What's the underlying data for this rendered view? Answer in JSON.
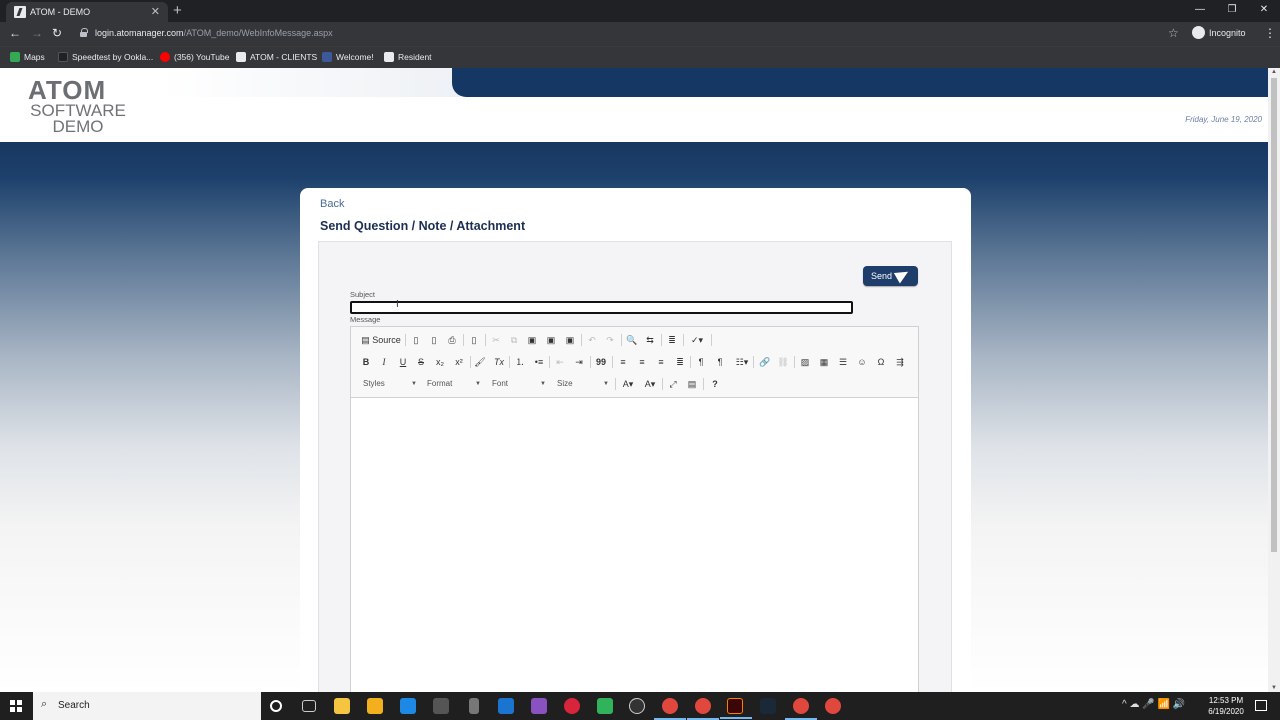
{
  "browser": {
    "tab_title": "ATOM - DEMO",
    "tab_close": "✕",
    "new_tab": "+",
    "url_host": "login.atomanager.com",
    "url_path": "/ATOM_demo/WebInfoMessage.aspx",
    "incognito_label": "Incognito",
    "window_controls": [
      "—",
      "❐",
      "✕"
    ],
    "bookmarks": [
      {
        "label": "Maps",
        "color": "#34a853"
      },
      {
        "label": "Speedtest by Ookla...",
        "color": "#202124"
      },
      {
        "label": "(356) YouTube",
        "color": "#ff0000"
      },
      {
        "label": "ATOM - CLIENTS",
        "color": "#e8eaed"
      },
      {
        "label": "Welcome!",
        "color": "#3c5a99"
      },
      {
        "label": "Resident",
        "color": "#e8eaed"
      }
    ]
  },
  "header": {
    "logo_top": "ATOM",
    "logo_mid": "SOFTWARE",
    "logo_bottom": "DEMO",
    "date": "Friday, June 19, 2020"
  },
  "form": {
    "back_label": "Back",
    "title": "Send Question / Note / Attachment",
    "send_label": "Send",
    "subject_label": "Subject",
    "subject_value": "",
    "message_label": "Message"
  },
  "editor": {
    "source_label": "Source",
    "styles_label": "Styles",
    "format_label": "Format",
    "font_label": "Font",
    "size_label": "Size",
    "help_label": "?",
    "bold_label": "B",
    "italic_label": "I",
    "underline_label": "U",
    "strike_label": "S",
    "subscript_label": "x₂",
    "superscript_label": "x²",
    "removeformat_label": "Tx",
    "omega_label": "Ω",
    "smiley_label": "☺",
    "blockquote_label": "99"
  },
  "taskbar": {
    "search_label": "Search",
    "time": "12:53 PM",
    "date": "6/19/2020",
    "tray": "^  ☁  🎤  📶  🔊"
  },
  "colors": {
    "brand_navy": "#153763",
    "send_button": "#1f3d6b",
    "link": "#4a6b9a"
  }
}
